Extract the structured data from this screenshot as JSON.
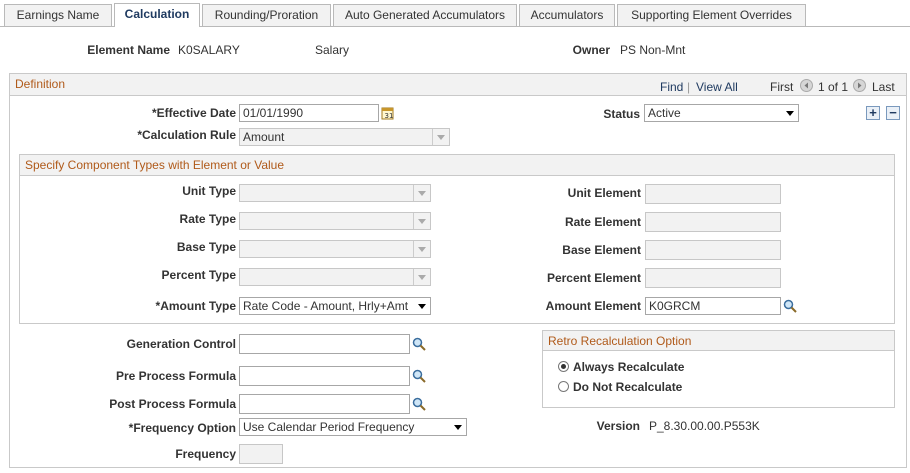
{
  "tabs": [
    {
      "label": "Earnings Name"
    },
    {
      "label": "Calculation"
    },
    {
      "label": "Rounding/Proration"
    },
    {
      "label": "Auto Generated Accumulators"
    },
    {
      "label": "Accumulators"
    },
    {
      "label": "Supporting Element Overrides"
    }
  ],
  "header": {
    "element_name_label": "Element Name",
    "element_name_value": "K0SALARY",
    "description": "Salary",
    "owner_label": "Owner",
    "owner_value": "PS Non-Mnt"
  },
  "definition": {
    "title": "Definition",
    "find": "Find",
    "view_all": "View All",
    "first": "First",
    "count": "1 of 1",
    "last": "Last",
    "effective_date_label": "*Effective Date",
    "effective_date_value": "01/01/1990",
    "status_label": "Status",
    "status_value": "Active",
    "calc_rule_label": "*Calculation Rule",
    "calc_rule_value": "Amount"
  },
  "components": {
    "title": "Specify Component Types with Element or Value",
    "unit_type_label": "Unit Type",
    "rate_type_label": "Rate Type",
    "base_type_label": "Base Type",
    "percent_type_label": "Percent Type",
    "amount_type_label": "*Amount Type",
    "amount_type_value": "Rate Code - Amount, Hrly+Amt",
    "unit_element_label": "Unit Element",
    "rate_element_label": "Rate Element",
    "base_element_label": "Base Element",
    "percent_element_label": "Percent Element",
    "amount_element_label": "Amount Element",
    "amount_element_value": "K0GRCM"
  },
  "lower": {
    "generation_control_label": "Generation Control",
    "pre_process_label": "Pre Process Formula",
    "post_process_label": "Post Process Formula",
    "frequency_option_label": "*Frequency Option",
    "frequency_option_value": "Use Calendar Period Frequency",
    "frequency_label": "Frequency",
    "version_label": "Version",
    "version_value": "P_8.30.00.00.P553K"
  },
  "retro": {
    "title": "Retro Recalculation Option",
    "always": "Always Recalculate",
    "never": "Do Not Recalculate"
  },
  "colors": {
    "section_title": "#b05a1a",
    "link": "#1f3a60"
  }
}
